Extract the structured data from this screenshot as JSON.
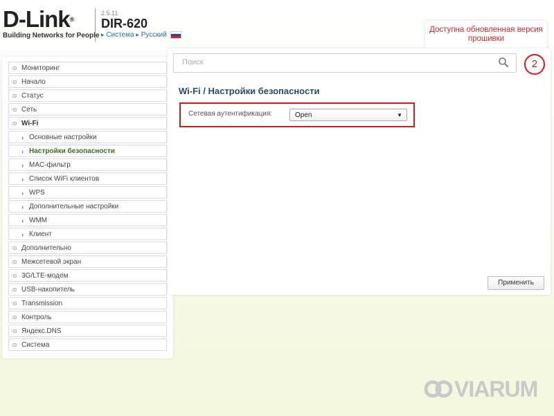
{
  "header": {
    "brand": "D-Link",
    "brand_mark": "®",
    "tagline": "Building Networks for People",
    "firmware_version": "2.5.11",
    "model": "DIR-620",
    "crumb_system": "Система",
    "crumb_language": "Русский",
    "update_notice": "Доступна обновленная версия прошивки"
  },
  "sidebar": {
    "items": [
      {
        "label": "Мониторинг"
      },
      {
        "label": "Начало"
      },
      {
        "label": "Статус"
      },
      {
        "label": "Сеть"
      },
      {
        "label": "Wi-Fi"
      },
      {
        "label": "Основные настройки"
      },
      {
        "label": "Настройки безопасности"
      },
      {
        "label": "MAC-фильтр"
      },
      {
        "label": "Список WiFi клиентов"
      },
      {
        "label": "WPS"
      },
      {
        "label": "Дополнительные настройки"
      },
      {
        "label": "WMM"
      },
      {
        "label": "Клиент"
      },
      {
        "label": "Дополнительно"
      },
      {
        "label": "Межсетевой экран"
      },
      {
        "label": "3G/LTE-модем"
      },
      {
        "label": "USB-накопитель"
      },
      {
        "label": "Transmission"
      },
      {
        "label": "Контроль"
      },
      {
        "label": "Яндекс.DNS"
      },
      {
        "label": "Система"
      }
    ]
  },
  "search": {
    "placeholder": "Поиск"
  },
  "annotation_badge": "2",
  "page": {
    "title": "Wi-Fi /  Настройки безопасности",
    "auth_label": "Сетевая аутентификация:",
    "auth_value": "Open",
    "apply_label": "Применить"
  },
  "watermark": "VIARUM",
  "colors": {
    "highlight_red": "#d0191d",
    "title_blue": "#2b4a66",
    "active_green": "#3d6b26",
    "update_red": "#cc2a2a"
  }
}
